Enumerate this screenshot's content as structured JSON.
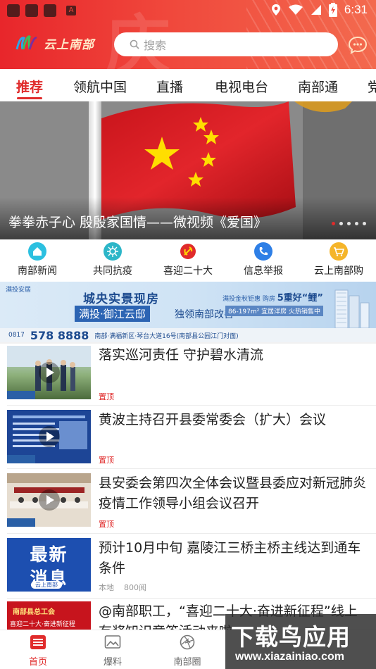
{
  "status_bar": {
    "time": "6:31"
  },
  "header": {
    "app_name": "云上南部",
    "search_placeholder": "搜索",
    "deco_glyph": "庆"
  },
  "tabs": [
    {
      "label": "推荐",
      "active": true
    },
    {
      "label": "领航中国",
      "active": false
    },
    {
      "label": "直播",
      "active": false
    },
    {
      "label": "电视电台",
      "active": false
    },
    {
      "label": "南部通",
      "active": false
    },
    {
      "label": "党",
      "active": false
    }
  ],
  "banner": {
    "caption": "拳拳赤子心 殷殷家国情——微视频《爱国》",
    "dot_count": 5,
    "active_dot": 0
  },
  "quick_nav": [
    {
      "label": "南部新闻",
      "icon": "home-icon",
      "color": "#2cc0e0"
    },
    {
      "label": "共同抗疫",
      "icon": "virus-icon",
      "color": "#2cb6c8"
    },
    {
      "label": "喜迎二十大",
      "icon": "party-emblem-icon",
      "color": "#e02b2b"
    },
    {
      "label": "信息举报",
      "icon": "phone-icon",
      "color": "#2e7fe6"
    },
    {
      "label": "云上南部购",
      "icon": "cart-icon",
      "color": "#f5b52a"
    }
  ],
  "ad": {
    "brand": "满投安居",
    "headline": "城央实景现房",
    "sub_left": "满投·御江云邸",
    "sub_right": "独领南部改善",
    "promo_top": "满投金秋钜惠 购房",
    "promo_highlight": "5重好“鲤”",
    "promo_bottom": "86-197m² 宜居洋房 火热销售中",
    "phone_prefix": "0817",
    "phone": "578 8888",
    "address": "南部·满福新区·琴台大道16号(南部县公园江门对面)"
  },
  "news": [
    {
      "title": "落实巡河责任 守护碧水清流",
      "tag": "置顶",
      "meta": "",
      "thumb": "video"
    },
    {
      "title": "黄波主持召开县委常委会（扩大）会议",
      "tag": "置顶",
      "meta": "",
      "thumb": "video"
    },
    {
      "title": "县安委会第四次全体会议暨县委应对新冠肺炎疫情工作领导小组会议召开",
      "tag": "置顶",
      "meta": "",
      "thumb": "video"
    },
    {
      "title": "预计10月中旬 嘉陵江三桥主桥主线达到通车条件",
      "tag": "",
      "meta_source": "本地",
      "meta_views": "800阅",
      "thumb": "latest",
      "thumb_text_1": "最新",
      "thumb_text_2": "消息",
      "thumb_text_3": "云上南部"
    },
    {
      "title": "@南部职工，“喜迎二十大·奋进新征程”线上有奖知识竞答活动来啦",
      "tag": "",
      "meta": "",
      "thumb": "union",
      "thumb_text_1": "南部县总工会",
      "thumb_text_2": "喜迎二十大·奋进新征程"
    }
  ],
  "bottom_nav": [
    {
      "label": "首页",
      "icon": "home-list-icon",
      "active": true
    },
    {
      "label": "爆料",
      "icon": "image-icon",
      "active": false
    },
    {
      "label": "南部圈",
      "icon": "aperture-icon",
      "active": false
    }
  ],
  "watermark": {
    "main": "下载鸟应用",
    "sub": "www.xiazainiao.com"
  },
  "colors": {
    "brand_red": "#e02b2b",
    "header_gradient_start": "#e8262b",
    "header_gradient_end": "#f36a4e"
  }
}
